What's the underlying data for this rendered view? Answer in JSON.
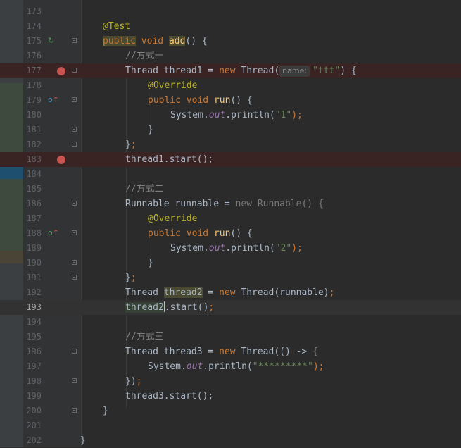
{
  "editor": {
    "current_line": "193",
    "lines": [
      {
        "n": "173"
      },
      {
        "n": "174",
        "tokens": [
          "@Test"
        ]
      },
      {
        "n": "175",
        "tokens": [
          "public",
          "void",
          "add",
          "() {"
        ]
      },
      {
        "n": "176",
        "tokens": [
          "//方式一"
        ]
      },
      {
        "n": "177",
        "tokens": [
          "Thread thread1 = ",
          "new",
          " Thread(",
          "name:",
          "\"ttt\"",
          ") {"
        ]
      },
      {
        "n": "178",
        "tokens": [
          "@Override"
        ]
      },
      {
        "n": "179",
        "tokens": [
          "public",
          "void",
          "run",
          "() {"
        ]
      },
      {
        "n": "180",
        "tokens": [
          "System.",
          "out",
          ".println(",
          "\"1\"",
          ");"
        ]
      },
      {
        "n": "181",
        "tokens": [
          "}"
        ]
      },
      {
        "n": "182",
        "tokens": [
          "}",
          ";"
        ]
      },
      {
        "n": "183",
        "tokens": [
          "thread1.start();"
        ]
      },
      {
        "n": "184"
      },
      {
        "n": "185",
        "tokens": [
          "//方式二"
        ]
      },
      {
        "n": "186",
        "tokens": [
          "Runnable runnable = ",
          "new Runnable() {"
        ]
      },
      {
        "n": "187",
        "tokens": [
          "@Override"
        ]
      },
      {
        "n": "188",
        "tokens": [
          "public",
          "void",
          "run",
          "() {"
        ]
      },
      {
        "n": "189",
        "tokens": [
          "System.",
          "out",
          ".println(",
          "\"2\"",
          ");"
        ]
      },
      {
        "n": "190",
        "tokens": [
          "}"
        ]
      },
      {
        "n": "191",
        "tokens": [
          "}",
          ";"
        ]
      },
      {
        "n": "192",
        "tokens": [
          "Thread ",
          "thread2",
          " = ",
          "new",
          " Thread(runnable)",
          ";"
        ]
      },
      {
        "n": "193",
        "tokens": [
          "thread2",
          ".start()",
          ";"
        ]
      },
      {
        "n": "194"
      },
      {
        "n": "195",
        "tokens": [
          "//方式三"
        ]
      },
      {
        "n": "196",
        "tokens": [
          "Thread thread3 = ",
          "new",
          " Thread(() -> ",
          "{"
        ]
      },
      {
        "n": "197",
        "tokens": [
          "System.",
          "out",
          ".println(",
          "\"*********\"",
          ");"
        ]
      },
      {
        "n": "198",
        "tokens": [
          "})",
          ";"
        ]
      },
      {
        "n": "199",
        "tokens": [
          "thread3.start();"
        ]
      },
      {
        "n": "200",
        "tokens": [
          "}"
        ]
      },
      {
        "n": "201"
      },
      {
        "n": "202",
        "tokens": [
          "}"
        ]
      }
    ]
  },
  "colors": {
    "background": "#2b2b2b",
    "gutter": "#313335",
    "breakpoint": "#c75450",
    "keyword": "#cc7832",
    "annotation": "#bbb529",
    "string": "#6a8759",
    "comment": "#808080",
    "method": "#ffc66d",
    "field": "#9876aa",
    "text": "#a9b7c6"
  },
  "icons": {
    "run_test": "run-test-icon",
    "override": "override-method-icon",
    "breakpoint": "breakpoint-icon",
    "fold": "fold-marker-icon"
  }
}
